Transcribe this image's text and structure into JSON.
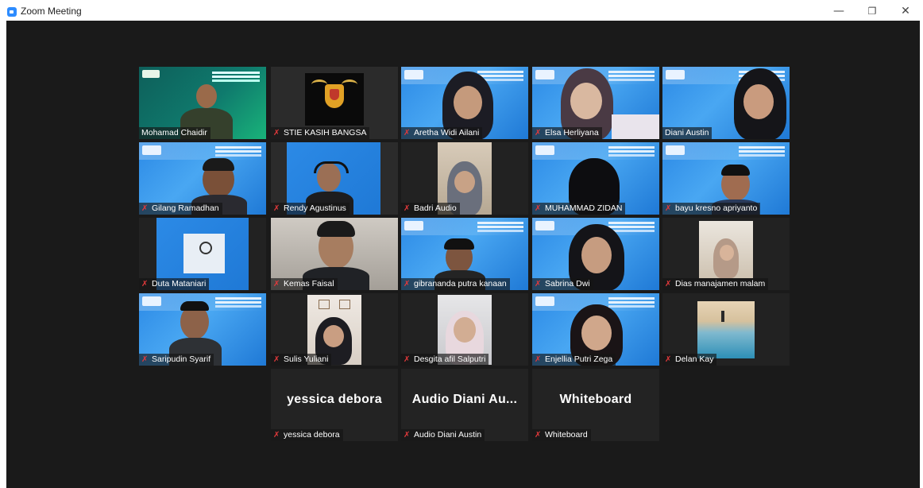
{
  "window": {
    "title": "Zoom Meeting",
    "minimize": "—",
    "restore": "❐",
    "close": "✕"
  },
  "colors": {
    "active_speaker_border": "#d8f029",
    "muted_icon": "#e0393b",
    "stage_background": "#1a1a1a"
  },
  "participants": [
    {
      "name": "Mohamad Chaidir",
      "muted": false,
      "active": true
    },
    {
      "name": "STIE KASIH BANGSA",
      "muted": true
    },
    {
      "name": "Aretha Widi Ailani",
      "muted": true
    },
    {
      "name": "Elsa Herliyana",
      "muted": true
    },
    {
      "name": "Diani Austin",
      "muted": false
    },
    {
      "name": "Gilang Ramadhan",
      "muted": true
    },
    {
      "name": "Rendy Agustinus",
      "muted": true
    },
    {
      "name": "Badri Audio",
      "muted": true
    },
    {
      "name": "MUHAMMAD ZIDAN",
      "muted": true
    },
    {
      "name": "bayu kresno apriyanto",
      "muted": true
    },
    {
      "name": "Duta Mataniari",
      "muted": true
    },
    {
      "name": "Kemas Faisal",
      "muted": true
    },
    {
      "name": "gibrananda putra kanaan",
      "muted": true
    },
    {
      "name": "Sabrina Dwi",
      "muted": true
    },
    {
      "name": "Dias manajamen malam",
      "muted": true
    },
    {
      "name": "Saripudin Syarif",
      "muted": true
    },
    {
      "name": "Sulis Yuliani",
      "muted": true
    },
    {
      "name": "Desgita afil Salputri",
      "muted": true
    },
    {
      "name": "Enjellia Putri Zega",
      "muted": true
    },
    {
      "name": "Delan Kay",
      "muted": true
    },
    {
      "name": "yessica debora",
      "muted": true,
      "display_text": "yessica debora"
    },
    {
      "name": "Audio Diani Austin",
      "muted": true,
      "display_text": "Audio Diani Au..."
    },
    {
      "name": "Whiteboard",
      "muted": true,
      "display_text": "Whiteboard"
    }
  ]
}
